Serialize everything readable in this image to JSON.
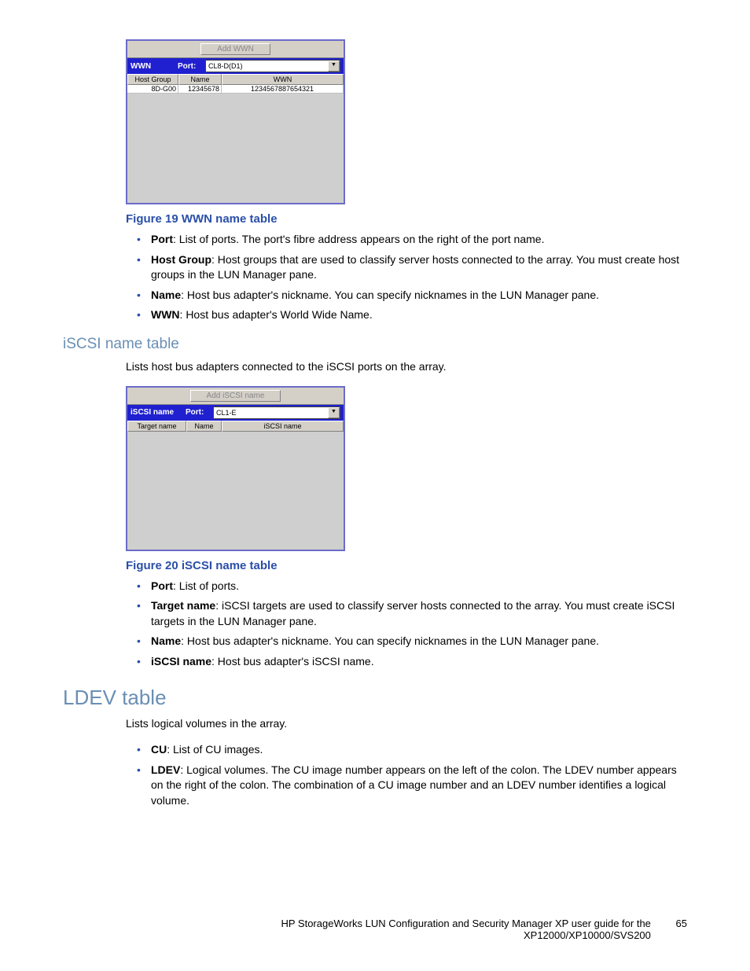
{
  "wwn_screenshot": {
    "add_button": "Add WWN",
    "title": "WWN",
    "port_label": "Port:",
    "port_value": "CL8-D(D1)",
    "columns": {
      "c1": "Host Group",
      "c2": "Name",
      "c3": "WWN"
    },
    "row": {
      "c1": "8D-G00",
      "c2": "12345678",
      "c3": "1234567887654321"
    }
  },
  "fig19_caption": "Figure 19 WWN name table",
  "wwn_bullets": {
    "b1_label": "Port",
    "b1_text": ": List of ports. The port's fibre address appears on the right of the port name.",
    "b2_label": "Host Group",
    "b2_text": ": Host groups that are used to classify server hosts connected to the array. You must create host groups in the LUN Manager pane.",
    "b3_label": "Name",
    "b3_text": ": Host bus adapter's nickname. You can specify nicknames in the LUN Manager pane.",
    "b4_label": "WWN",
    "b4_text": ": Host bus adapter's World Wide Name."
  },
  "iscsi_heading": "iSCSI name table",
  "iscsi_intro": "Lists host bus adapters connected to the iSCSI ports on the array.",
  "iscsi_screenshot": {
    "add_button": "Add iSCSI name",
    "title": "iSCSI name",
    "port_label": "Port:",
    "port_value": "CL1-E",
    "columns": {
      "c1": "Target name",
      "c2": "Name",
      "c3": "iSCSI name"
    }
  },
  "fig20_caption": "Figure 20 iSCSI name table",
  "iscsi_bullets": {
    "b1_label": "Port",
    "b1_text": ": List of ports.",
    "b2_label": "Target name",
    "b2_text": ": iSCSI targets are used to classify server hosts connected to the array. You must create iSCSI targets in the LUN Manager pane.",
    "b3_label": "Name",
    "b3_text": ": Host bus adapter's nickname. You can specify nicknames in the LUN Manager pane.",
    "b4_label": "iSCSI name",
    "b4_text": ": Host bus adapter's iSCSI name."
  },
  "ldev_heading": "LDEV table",
  "ldev_intro": "Lists logical volumes in the array.",
  "ldev_bullets": {
    "b1_label": "CU",
    "b1_text": ": List of CU images.",
    "b2_label": "LDEV",
    "b2_text": ": Logical volumes. The CU image number appears on the left of the colon. The LDEV number appears on the right of the colon. The combination of a CU image number and an LDEV number identifies a logical volume."
  },
  "footer": {
    "line1": "HP StorageWorks LUN Configuration and Security Manager XP user guide for the",
    "line2": "XP12000/XP10000/SVS200",
    "page": "65"
  }
}
